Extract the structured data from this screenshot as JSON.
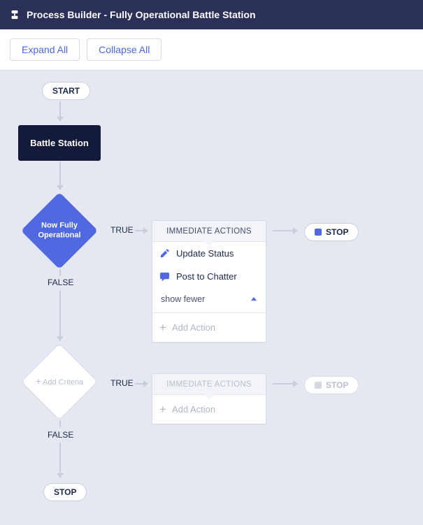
{
  "header": {
    "title": "Process Builder - Fully Operational Battle Station"
  },
  "toolbar": {
    "expand": "Expand All",
    "collapse": "Collapse All"
  },
  "start": "START",
  "stop": "STOP",
  "stop_end": "STOP",
  "object_node": "Battle Station",
  "true_label": "TRUE",
  "false_label": "FALSE",
  "criteria1": {
    "label_line1": "Now Fully",
    "label_line2": "Operational",
    "actions_title": "IMMEDIATE ACTIONS",
    "actions": [
      {
        "icon": "pencil",
        "label": "Update Status"
      },
      {
        "icon": "chat",
        "label": "Post to Chatter"
      }
    ],
    "show_fewer": "show fewer",
    "add_action": "Add Action"
  },
  "criteria2": {
    "label": "Add Criteria",
    "actions_title": "IMMEDIATE ACTIONS",
    "add_action": "Add Action"
  }
}
